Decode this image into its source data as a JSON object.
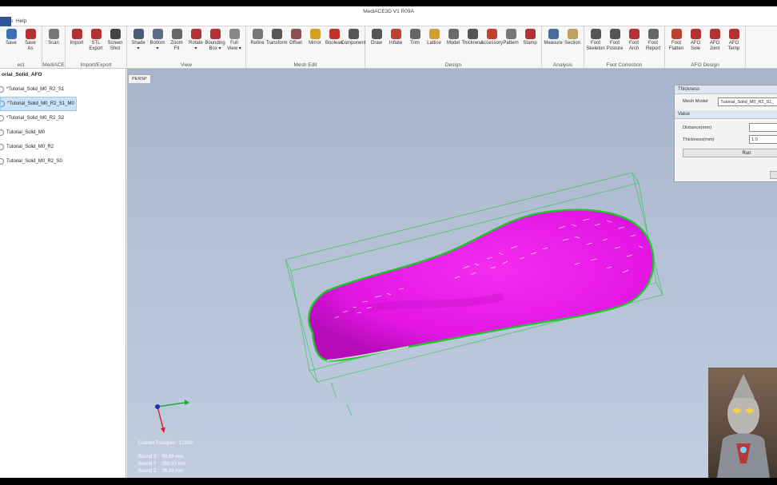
{
  "app": {
    "title": "MediACE3D V1 R09A",
    "menu": [
      "File",
      "Help"
    ]
  },
  "ribbon": {
    "groups": [
      {
        "label": "ect",
        "tools": [
          {
            "label": "Save",
            "icon": "save-icon",
            "color": "#3a6fb5"
          },
          {
            "label": "Save\nAs",
            "icon": "save-as-icon",
            "color": "#b03232"
          }
        ]
      },
      {
        "label": "MediACE",
        "tools": [
          {
            "label": "Scan",
            "icon": "scan-icon",
            "color": "#777777"
          }
        ]
      },
      {
        "label": "Import/Export",
        "tools": [
          {
            "label": "Import",
            "icon": "import-icon",
            "color": "#b03232"
          },
          {
            "label": "STL\nExport",
            "icon": "stl-export-icon",
            "color": "#b03232"
          },
          {
            "label": "Screen\nShot",
            "icon": "camera-icon",
            "color": "#444444"
          }
        ]
      },
      {
        "label": "View",
        "tools": [
          {
            "label": "Shade\n▾",
            "icon": "shade-icon",
            "color": "#4a5a78"
          },
          {
            "label": "Bottom\n▾",
            "icon": "bottom-view-icon",
            "color": "#5a6a88"
          },
          {
            "label": "Zoom\nFit",
            "icon": "zoom-fit-icon",
            "color": "#666666"
          },
          {
            "label": "Rotate\n▾",
            "icon": "rotate-icon",
            "color": "#b03232"
          },
          {
            "label": "Bounding\nBox ▾",
            "icon": "bounding-box-icon",
            "color": "#b03232"
          },
          {
            "label": "Full\nView ▾",
            "icon": "full-view-icon",
            "color": "#888888"
          }
        ]
      },
      {
        "label": "Mesh Edit",
        "tools": [
          {
            "label": "Refine",
            "icon": "refine-icon",
            "color": "#777777"
          },
          {
            "label": "Transform",
            "icon": "transform-icon",
            "color": "#555555"
          },
          {
            "label": "Offset",
            "icon": "offset-icon",
            "color": "#8a5050"
          },
          {
            "label": "Mirror",
            "icon": "mirror-icon",
            "color": "#d0a020"
          },
          {
            "label": "Boolean",
            "icon": "boolean-icon",
            "color": "#c03030"
          },
          {
            "label": "Component",
            "icon": "component-icon",
            "color": "#555555"
          }
        ]
      },
      {
        "label": "Design",
        "tools": [
          {
            "label": "Draw",
            "icon": "draw-icon",
            "color": "#555555"
          },
          {
            "label": "Inflate",
            "icon": "inflate-icon",
            "color": "#c04030"
          },
          {
            "label": "Trim",
            "icon": "trim-icon",
            "color": "#666666"
          },
          {
            "label": "Lattice",
            "icon": "lattice-icon",
            "color": "#d0a030"
          },
          {
            "label": "Model",
            "icon": "model-icon",
            "color": "#6a6a6a"
          },
          {
            "label": "Thickness",
            "icon": "thickness-icon",
            "color": "#555555"
          },
          {
            "label": "Accessory",
            "icon": "accessory-icon",
            "color": "#c04030"
          },
          {
            "label": "Pattern",
            "icon": "pattern-icon",
            "color": "#777777"
          },
          {
            "label": "Stamp",
            "icon": "stamp-icon",
            "color": "#b03232"
          }
        ]
      },
      {
        "label": "Analysis",
        "tools": [
          {
            "label": "Measure",
            "icon": "measure-icon",
            "color": "#4a6a9a"
          },
          {
            "label": "Section",
            "icon": "section-icon",
            "color": "#c0a060"
          }
        ]
      },
      {
        "label": "Foot Correction",
        "tools": [
          {
            "label": "Foot\nSkeleton",
            "icon": "foot-skeleton-icon",
            "color": "#555555"
          },
          {
            "label": "Foot\nPosture",
            "icon": "foot-posture-icon",
            "color": "#555555"
          },
          {
            "label": "Foot\nArch",
            "icon": "foot-arch-icon",
            "color": "#b03232"
          },
          {
            "label": "Foot\nReport",
            "icon": "foot-report-icon",
            "color": "#666666"
          }
        ]
      },
      {
        "label": "AFO Design",
        "tools": [
          {
            "label": "Foot\nFlatten",
            "icon": "foot-flatten-icon",
            "color": "#c04030"
          },
          {
            "label": "AFO\nSole",
            "icon": "afo-sole-icon",
            "color": "#b03232"
          },
          {
            "label": "AFO\nJoint",
            "icon": "afo-joint-icon",
            "color": "#b03232"
          },
          {
            "label": "AFO\nTemp",
            "icon": "afo-temp-icon",
            "color": "#b03232"
          }
        ]
      }
    ]
  },
  "tree": {
    "root": "orial_Solid_AFO",
    "items": [
      "*Tutorial_Solid_M0_R2_S1",
      "*Tutorial_Solid_M0_R2_S1_M0",
      "*Tutorial_Solid_M0_R2_S2",
      "Tutorial_Solid_M0",
      "Tutorial_Solid_M0_R2",
      "Tutorial_Solid_M0_R2_S0"
    ],
    "selected_index": 1
  },
  "viewport": {
    "tab": "PERSP",
    "triangles": "Current Triangles : 17209",
    "bound_x": "Bound X :  98.99 mm",
    "bound_y": "Bound Y :  259.97 mm",
    "bound_z": "Bound Z :  26.28 mm",
    "mesh_color": "#ee18ee",
    "outline_color": "#22c32a"
  },
  "thickness_panel": {
    "title": "Thickness",
    "mesh_model_label": "Mesh Model",
    "mesh_model_value": "Tutorial_Solid_M0_R2_S1_",
    "value_header": "Value",
    "distance_label": "Distance(mm)",
    "distance_value": "",
    "thickness_label": "Thickness(mm)",
    "thickness_value": "1.0",
    "run_label": "Run"
  }
}
